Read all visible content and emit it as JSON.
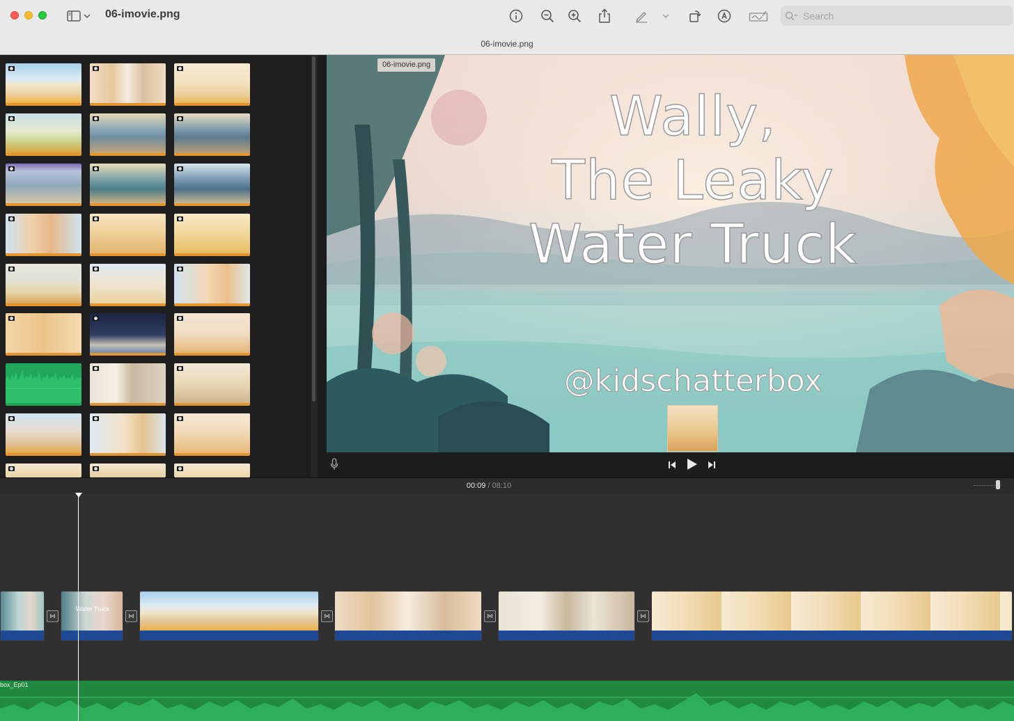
{
  "window": {
    "doc_title": "06-imovie.png",
    "tab_title": "06-imovie.png"
  },
  "toolbar": {
    "icons": [
      "sidebar-toggle-icon",
      "info-icon",
      "zoom-out-icon",
      "zoom-in-icon",
      "share-icon",
      "markup-pen-icon",
      "rotate-icon",
      "annotate-icon",
      "sign-icon"
    ],
    "search_placeholder": "Search"
  },
  "viewer": {
    "badge": "06-imovie.png",
    "title_lines": [
      "Wally,",
      "The Leaky",
      "Water Truck"
    ],
    "handle": "@kidschatterbox"
  },
  "timeline": {
    "current_time": "00:09",
    "separator": "/",
    "total_time": "08:10",
    "audio_label": "box_Ep01",
    "clip_overlay": "Water Truck"
  },
  "colors": {
    "accent_orange": "#e6952e",
    "clip_blue": "#1e4a95",
    "audio_green": "#1f8a3f"
  }
}
